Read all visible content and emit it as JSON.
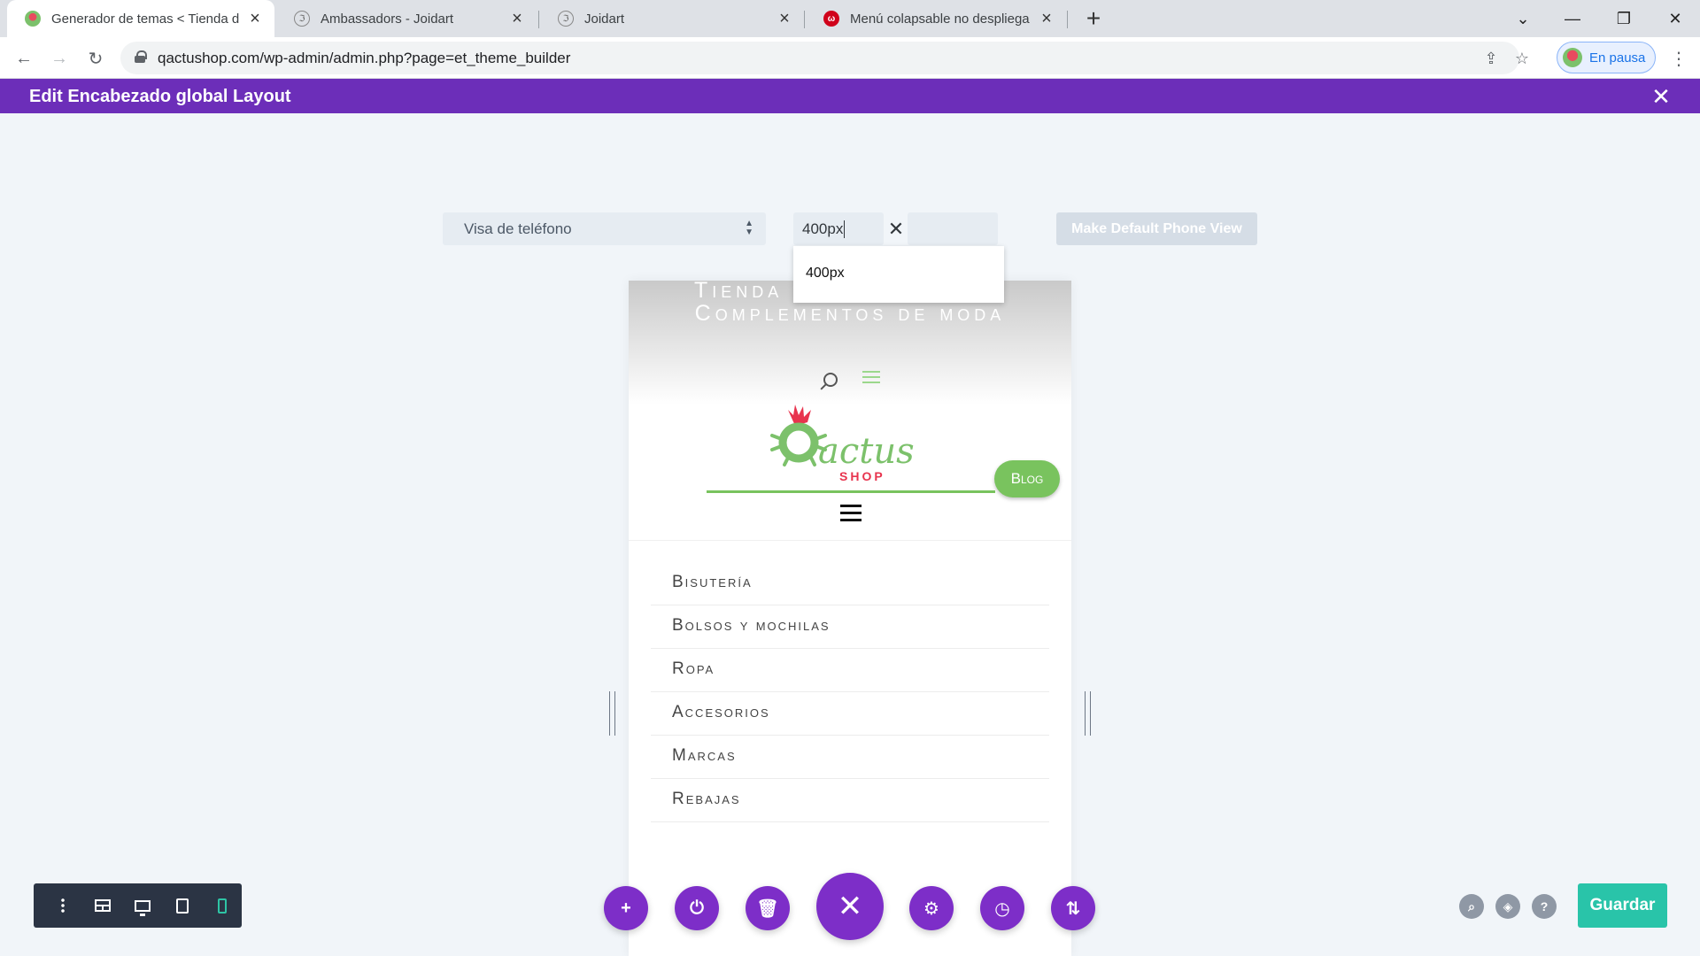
{
  "browser": {
    "tabs": [
      {
        "title": "Generador de temas < Tienda de",
        "active": true
      },
      {
        "title": "Ambassadors - Joidart",
        "active": false
      },
      {
        "title": "Joidart",
        "active": false
      },
      {
        "title": "Menú colapsable no despliega –",
        "active": false
      }
    ],
    "url": "qactushop.com/wp-admin/admin.php?page=et_theme_builder",
    "profile_label": "En pausa"
  },
  "builder": {
    "header_title": "Edit Encabezado global Layout",
    "view_select": "Visa de teléfono",
    "width_value": "400px",
    "suggestion": "400px",
    "default_button": "Make Default Phone View",
    "save_label": "Guardar"
  },
  "preview": {
    "site_title_line1": "Tienda",
    "site_title_line2": "Complementos de moda",
    "logo_word": "actus",
    "logo_sub": "SHOP",
    "blog_label": "Blog",
    "menu": [
      "Bisutería",
      "Bolsos y mochilas",
      "Ropa",
      "Accesorios",
      "Marcas",
      "Rebajas"
    ]
  },
  "colors": {
    "divi_purple": "#6c2eb9",
    "action_purple": "#7d2ec8",
    "save_green": "#29c4a9",
    "brand_green": "#79c35e"
  }
}
